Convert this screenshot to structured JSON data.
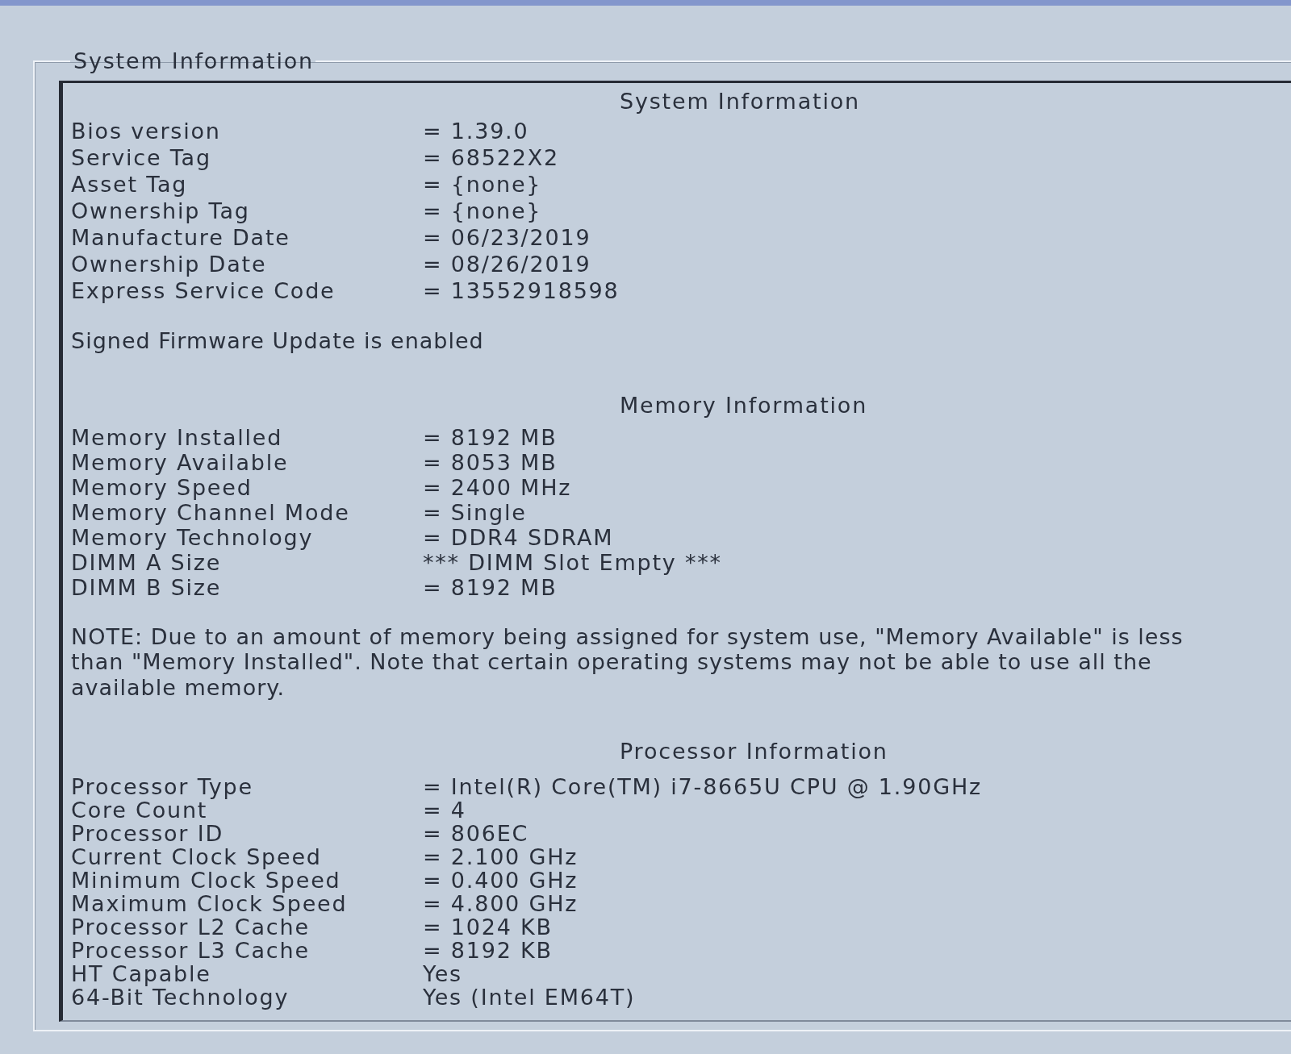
{
  "group_box": {
    "title": "System Information",
    "sections": [
      {
        "heading": "System Information",
        "rows": [
          {
            "label": "Bios version",
            "value": "= 1.39.0"
          },
          {
            "label": "Service Tag",
            "value": "= 68522X2"
          },
          {
            "label": "Asset Tag",
            "value": "= {none}"
          },
          {
            "label": "Ownership Tag",
            "value": "= {none}"
          },
          {
            "label": "Manufacture Date",
            "value": "= 06/23/2019"
          },
          {
            "label": "Ownership Date",
            "value": "= 08/26/2019"
          },
          {
            "label": "Express Service Code",
            "value": "= 13552918598"
          }
        ],
        "notes": [
          "Signed Firmware Update is enabled"
        ]
      },
      {
        "heading": "Memory Information",
        "rows": [
          {
            "label": "Memory Installed",
            "value": "= 8192 MB"
          },
          {
            "label": "Memory Available",
            "value": "= 8053 MB"
          },
          {
            "label": "Memory Speed",
            "value": "= 2400 MHz"
          },
          {
            "label": "Memory Channel Mode",
            "value": "= Single"
          },
          {
            "label": "Memory Technology",
            "value": "= DDR4 SDRAM"
          },
          {
            "label": "DIMM A Size",
            "value": "*** DIMM Slot Empty ***"
          },
          {
            "label": "DIMM B Size",
            "value": "= 8192 MB"
          }
        ],
        "notes": [
          "NOTE: Due to an amount of memory being assigned for system use, \"Memory Available\" is less than \"Memory Installed\". Note that certain operating systems may not be able to use all the available memory."
        ]
      },
      {
        "heading": "Processor Information",
        "rows": [
          {
            "label": "Processor Type",
            "value": "= Intel(R) Core(TM) i7-8665U CPU @ 1.90GHz"
          },
          {
            "label": "Core Count",
            "value": "= 4"
          },
          {
            "label": "Processor ID",
            "value": "= 806EC"
          },
          {
            "label": "Current Clock Speed",
            "value": "= 2.100 GHz"
          },
          {
            "label": "Minimum Clock Speed",
            "value": "= 0.400 GHz"
          },
          {
            "label": "Maximum Clock Speed",
            "value": "= 4.800 GHz"
          },
          {
            "label": "Processor L2 Cache",
            "value": "= 1024 KB"
          },
          {
            "label": "Processor L3 Cache",
            "value": "= 8192 KB"
          },
          {
            "label": "HT Capable",
            "value": "Yes"
          },
          {
            "label": "64-Bit Technology",
            "value": "Yes (Intel EM64T)"
          }
        ]
      }
    ]
  }
}
